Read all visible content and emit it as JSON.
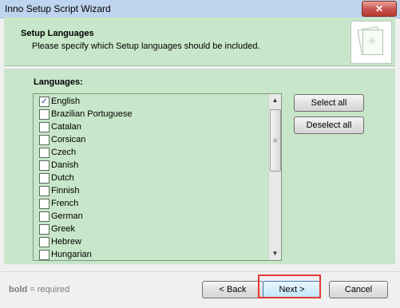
{
  "window": {
    "title": "Inno Setup Script Wizard",
    "close_glyph": "✕"
  },
  "header": {
    "heading": "Setup Languages",
    "subheading": "Please specify which Setup languages should be included."
  },
  "languages": {
    "label": "Languages:",
    "items": [
      {
        "label": "English",
        "checked": true
      },
      {
        "label": "Brazilian Portuguese",
        "checked": false
      },
      {
        "label": "Catalan",
        "checked": false
      },
      {
        "label": "Corsican",
        "checked": false
      },
      {
        "label": "Czech",
        "checked": false
      },
      {
        "label": "Danish",
        "checked": false
      },
      {
        "label": "Dutch",
        "checked": false
      },
      {
        "label": "Finnish",
        "checked": false
      },
      {
        "label": "French",
        "checked": false
      },
      {
        "label": "German",
        "checked": false
      },
      {
        "label": "Greek",
        "checked": false
      },
      {
        "label": "Hebrew",
        "checked": false
      },
      {
        "label": "Hungarian",
        "checked": false
      }
    ]
  },
  "buttons": {
    "select_all": "Select all",
    "deselect_all": "Deselect all",
    "back": "< Back",
    "next": "Next >",
    "cancel": "Cancel"
  },
  "footer": {
    "bold_word": "bold",
    "legend_rest": " = required"
  },
  "icons": {
    "check": "✓",
    "scroll_up": "▲",
    "scroll_down": "▼",
    "grip": "≡"
  },
  "colors": {
    "panel": "#c8e6c9",
    "highlight": "#e53935"
  }
}
